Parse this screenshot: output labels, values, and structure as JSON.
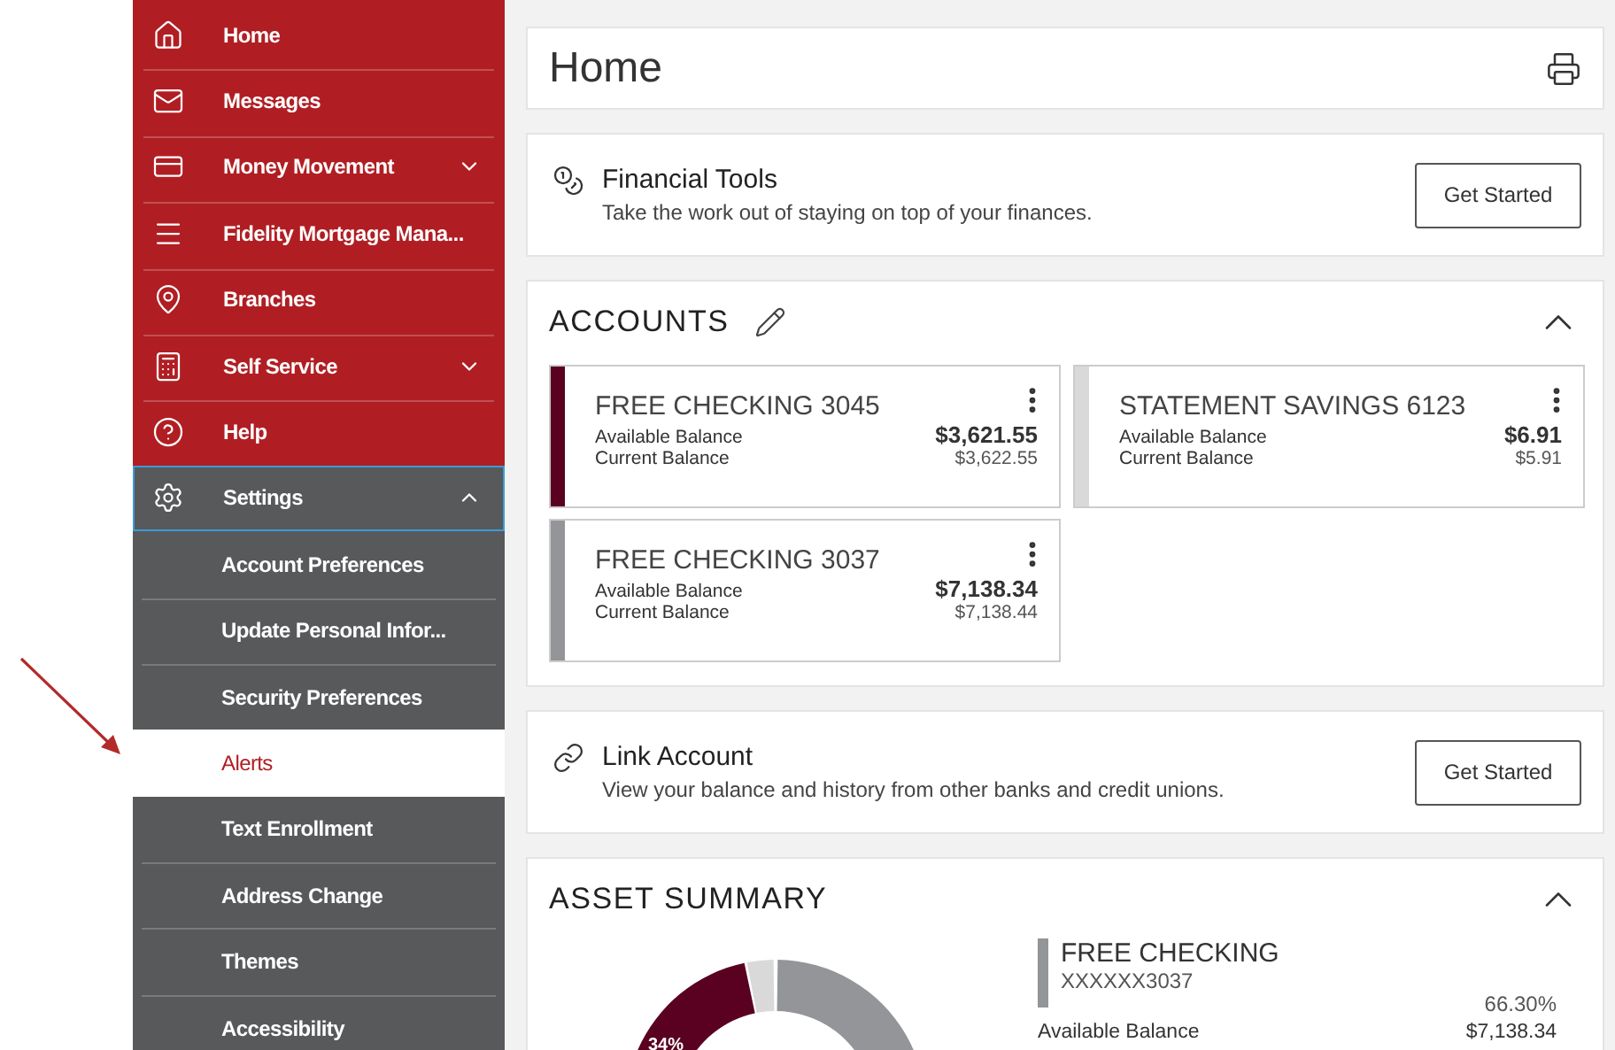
{
  "sidebar": {
    "items": [
      {
        "label": "Home"
      },
      {
        "label": "Messages"
      },
      {
        "label": "Money Movement",
        "expanded": false
      },
      {
        "label": "Fidelity Mortgage Mana..."
      },
      {
        "label": "Branches"
      },
      {
        "label": "Self Service",
        "expanded": false
      },
      {
        "label": "Help"
      },
      {
        "label": "Settings",
        "expanded": true,
        "children": [
          {
            "label": "Account Preferences",
            "selected": false
          },
          {
            "label": "Update Personal Infor...",
            "selected": false
          },
          {
            "label": "Security Preferences",
            "selected": false
          },
          {
            "label": "Alerts",
            "selected": true
          },
          {
            "label": "Text Enrollment",
            "selected": false
          },
          {
            "label": "Address Change",
            "selected": false
          },
          {
            "label": "Themes",
            "selected": false
          },
          {
            "label": "Accessibility",
            "selected": false
          }
        ]
      }
    ]
  },
  "page": {
    "title": "Home"
  },
  "financial_tools": {
    "title": "Financial Tools",
    "subtitle": "Take the work out of staying on top of your finances.",
    "button": "Get Started"
  },
  "accounts": {
    "title": "ACCOUNTS",
    "items": [
      {
        "name": "FREE CHECKING 3045",
        "color": "#5a0020",
        "available_label": "Available Balance",
        "available": "$3,621.55",
        "current_label": "Current Balance",
        "current": "$3,622.55"
      },
      {
        "name": "STATEMENT SAVINGS 6123",
        "color": "#d9d9d9",
        "available_label": "Available Balance",
        "available": "$6.91",
        "current_label": "Current Balance",
        "current": "$5.91"
      },
      {
        "name": "FREE CHECKING 3037",
        "color": "#939598",
        "available_label": "Available Balance",
        "available": "$7,138.34",
        "current_label": "Current Balance",
        "current": "$7,138.44"
      }
    ]
  },
  "link_account": {
    "title": "Link Account",
    "subtitle": "View your balance and history from other banks and credit unions.",
    "button": "Get Started"
  },
  "asset_summary": {
    "title": "ASSET SUMMARY",
    "chart_label": "34%",
    "detail": {
      "name": "FREE CHECKING",
      "number": "XXXXXX3037",
      "color": "#939598",
      "percent": "66.30%",
      "balance_label": "Available Balance",
      "balance": "$7,138.34"
    }
  }
}
